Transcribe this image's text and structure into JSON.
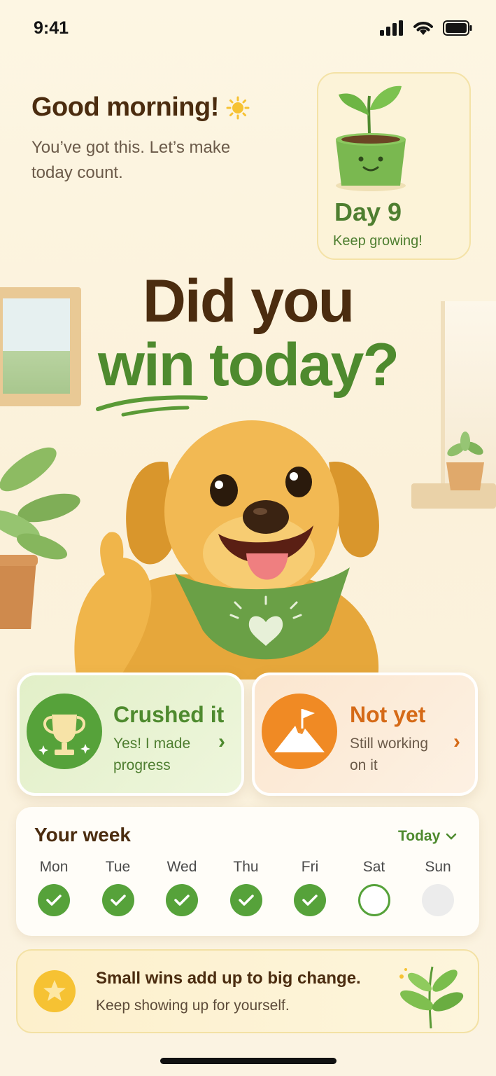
{
  "status_bar": {
    "time": "9:41"
  },
  "greeting": {
    "title": "Good morning!",
    "subtitle": "You’ve got this. Let’s make today count."
  },
  "streak": {
    "day_label": "Day 9",
    "caption": "Keep growing!"
  },
  "headline": {
    "line1": "Did you",
    "line2": "win today?"
  },
  "choices": [
    {
      "title": "Crushed it",
      "subtitle_1": "Yes! I made",
      "subtitle_2": "progress",
      "icon": "trophy-icon",
      "color": "#56a23a"
    },
    {
      "title": "Not yet",
      "subtitle_1": "Still working",
      "subtitle_2": "on it",
      "icon": "mountain-flag-icon",
      "color": "#f08a24"
    }
  ],
  "week": {
    "title": "Your week",
    "filter_label": "Today",
    "days": [
      {
        "name": "Mon",
        "status": "done"
      },
      {
        "name": "Tue",
        "status": "done"
      },
      {
        "name": "Wed",
        "status": "done"
      },
      {
        "name": "Thu",
        "status": "done"
      },
      {
        "name": "Fri",
        "status": "done"
      },
      {
        "name": "Sat",
        "status": "today"
      },
      {
        "name": "Sun",
        "status": "future"
      }
    ]
  },
  "banner": {
    "title": "Small wins add up to big change.",
    "subtitle": "Keep showing up for yourself."
  },
  "colors": {
    "accent_green": "#56a23a",
    "accent_orange": "#f08a24",
    "text_brown": "#4b2c0f",
    "background": "#fdf6e3"
  }
}
